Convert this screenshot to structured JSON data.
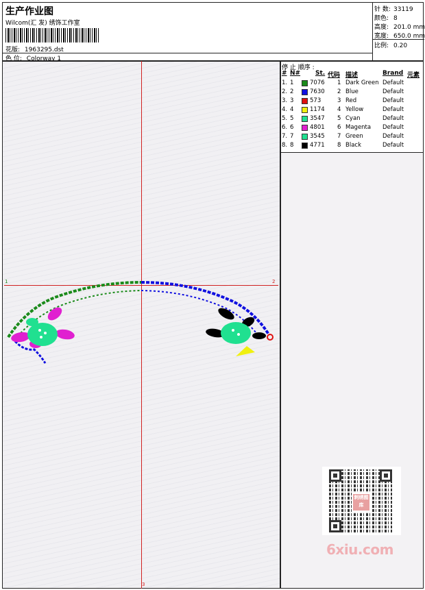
{
  "header": {
    "title": "生产作业图",
    "software": "Wilcom(汇 发) 绣饰工作室",
    "pattern_label": "花版:",
    "pattern_value": "1963295.dst",
    "colorway_label": "色 位:",
    "colorway_value": "Colorway 1"
  },
  "stats": {
    "stitches_label": "针 数:",
    "stitches_value": "33119",
    "colors_label": "颜色:",
    "colors_value": "8",
    "height_label": "高度:",
    "height_value": "201.0 mm",
    "width_label": "宽度:",
    "width_value": "650.0 mm",
    "scale_label": "比例:",
    "scale_value": "0.20"
  },
  "canvas": {
    "marker_left": "1",
    "marker_right": "2",
    "marker_bottom": "3"
  },
  "stop_sequence": {
    "title": "停 止 顺序 :",
    "columns": [
      "#",
      "N#",
      "St.",
      "代码",
      "描述",
      "Brand",
      "元素"
    ],
    "rows": [
      {
        "seq": "1.",
        "n": "1",
        "color": "#1a8a1a",
        "stitches": "7076",
        "code": "1",
        "desc": "Dark Green",
        "brand": "Default"
      },
      {
        "seq": "2.",
        "n": "2",
        "color": "#1010e0",
        "stitches": "7630",
        "code": "2",
        "desc": "Blue",
        "brand": "Default"
      },
      {
        "seq": "3.",
        "n": "3",
        "color": "#e01010",
        "stitches": "573",
        "code": "3",
        "desc": "Red",
        "brand": "Default"
      },
      {
        "seq": "4.",
        "n": "4",
        "color": "#f0f010",
        "stitches": "1174",
        "code": "4",
        "desc": "Yellow",
        "brand": "Default"
      },
      {
        "seq": "5.",
        "n": "5",
        "color": "#20e090",
        "stitches": "3547",
        "code": "5",
        "desc": "Cyan",
        "brand": "Default"
      },
      {
        "seq": "6.",
        "n": "6",
        "color": "#e020d0",
        "stitches": "4801",
        "code": "6",
        "desc": "Magenta",
        "brand": "Default"
      },
      {
        "seq": "7.",
        "n": "7",
        "color": "#20e090",
        "stitches": "3545",
        "code": "7",
        "desc": "Green",
        "brand": "Default"
      },
      {
        "seq": "8.",
        "n": "8",
        "color": "#000000",
        "stitches": "4771",
        "code": "8",
        "desc": "Black",
        "brand": "Default"
      }
    ]
  },
  "watermark": {
    "text": "6xiu.com",
    "qr_logo": "刺绣图库"
  }
}
